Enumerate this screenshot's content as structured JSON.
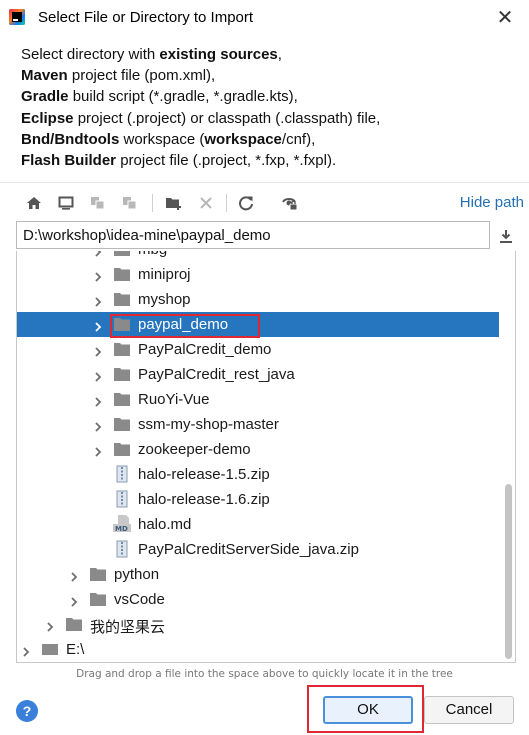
{
  "window": {
    "title": "Select File or Directory to Import",
    "close_glyph": "✕"
  },
  "description": {
    "line1": {
      "a": "Select directory with ",
      "b": "existing sources",
      "c": ","
    },
    "line2": {
      "a": "Maven",
      "b": " project file (pom.xml),"
    },
    "line3": {
      "a": "Gradle",
      "b": " build script (*.gradle, *.gradle.kts),"
    },
    "line4": {
      "a": "Eclipse",
      "b": " project (.project) or classpath (.classpath) file,"
    },
    "line5": {
      "a": "Bnd/Bndtools",
      "b": " workspace (",
      "c": "workspace",
      "d": "/cnf),"
    },
    "line6": {
      "a": "Flash Builder",
      "b": " project file (.project, *.fxp, *.fxpl)."
    }
  },
  "toolbar": {
    "buttons": [
      "home-icon",
      "desktop-icon",
      "project-icon",
      "module-icon",
      "new-folder-icon",
      "delete-icon",
      "refresh-icon",
      "show-hidden-icon"
    ],
    "hide_path_label": "Hide path"
  },
  "path": {
    "value": "D:\\workshop\\idea-mine\\paypal_demo"
  },
  "tree": {
    "items": [
      {
        "label": "mbg",
        "type": "folder",
        "level": 3,
        "expandable": true
      },
      {
        "label": "miniproj",
        "type": "folder",
        "level": 3,
        "expandable": true
      },
      {
        "label": "myshop",
        "type": "folder",
        "level": 3,
        "expandable": true
      },
      {
        "label": "paypal_demo",
        "type": "folder",
        "level": 3,
        "expandable": true,
        "selected": true
      },
      {
        "label": "PayPalCredit_demo",
        "type": "folder",
        "level": 3,
        "expandable": true
      },
      {
        "label": "PayPalCredit_rest_java",
        "type": "folder",
        "level": 3,
        "expandable": true
      },
      {
        "label": "RuoYi-Vue",
        "type": "folder",
        "level": 3,
        "expandable": true
      },
      {
        "label": "ssm-my-shop-master",
        "type": "folder",
        "level": 3,
        "expandable": true
      },
      {
        "label": "zookeeper-demo",
        "type": "folder",
        "level": 3,
        "expandable": true
      },
      {
        "label": "halo-release-1.5.zip",
        "type": "zip",
        "level": 3,
        "expandable": false
      },
      {
        "label": "halo-release-1.6.zip",
        "type": "zip",
        "level": 3,
        "expandable": false
      },
      {
        "label": "halo.md",
        "type": "md",
        "level": 3,
        "expandable": false
      },
      {
        "label": "PayPalCreditServerSide_java.zip",
        "type": "zip",
        "level": 3,
        "expandable": false
      },
      {
        "label": "python",
        "type": "folder",
        "level": 2,
        "expandable": true
      },
      {
        "label": "vsCode",
        "type": "folder",
        "level": 2,
        "expandable": true
      },
      {
        "label": "我的坚果云",
        "type": "folder",
        "level": 1,
        "expandable": true
      },
      {
        "label": "E:\\",
        "type": "drive",
        "level": 0,
        "expandable": true
      }
    ]
  },
  "hint": "Drag and drop a file into the space above to quickly locate it in the tree",
  "footer": {
    "help_label": "?",
    "ok_label": "OK",
    "cancel_label": "Cancel"
  },
  "colors": {
    "selection": "#2675bf",
    "link": "#2470b3",
    "annotation_red": "#e02832",
    "folder": "#8a8a8a"
  }
}
